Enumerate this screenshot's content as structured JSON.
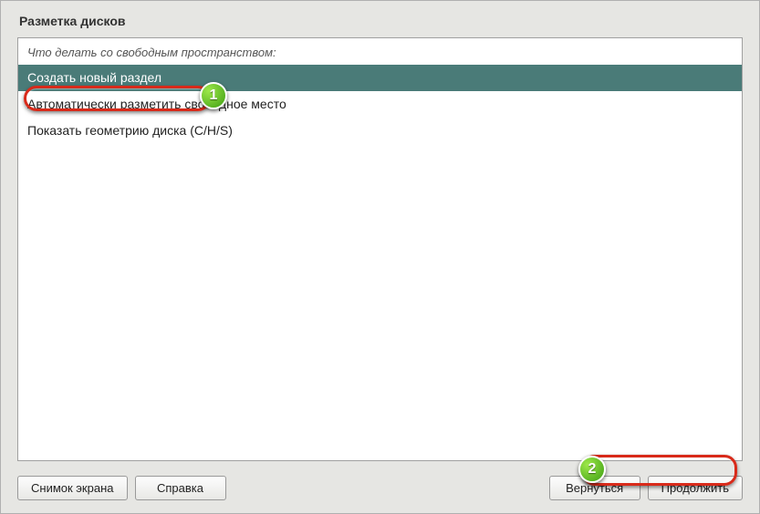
{
  "title": "Разметка дисков",
  "prompt": "Что делать со свободным пространством:",
  "options": [
    {
      "label": "Создать новый раздел",
      "selected": true
    },
    {
      "label": "Автоматически разметить свободное место",
      "selected": false
    },
    {
      "label": "Показать геометрию диска (C/H/S)",
      "selected": false
    }
  ],
  "buttons": {
    "screenshot": "Снимок экрана",
    "help": "Справка",
    "back": "Вернуться",
    "continue": "Продолжить"
  },
  "callouts": {
    "one": "1",
    "two": "2"
  }
}
